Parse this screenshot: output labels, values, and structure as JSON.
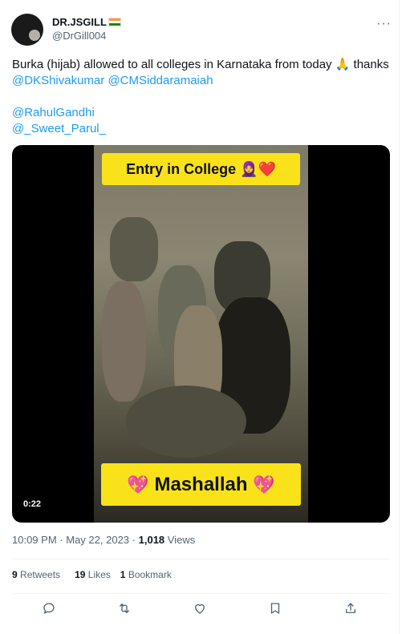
{
  "author": {
    "display_name": "DR.JSGILL",
    "handle": "@DrGill004",
    "flag_colors": [
      "#ff9933",
      "#ffffff",
      "#138808"
    ]
  },
  "tweet": {
    "line1": "Burka (hijab) allowed to all colleges in Karnataka from today 🙏 thanks",
    "mention1": "@DKShivakumar",
    "mention2": "@CMSiddaramaiah",
    "mention3": "@RahulGandhi",
    "mention4": "@_Sweet_Parul_"
  },
  "media": {
    "top_banner": "Entry in College 🧕❤️",
    "bottom_banner": "Mashallah",
    "bottom_banner_heart": "💖",
    "duration": "0:22"
  },
  "meta": {
    "time": "10:09 PM",
    "separator": "·",
    "date": "May 22, 2023",
    "views_count": "1,018",
    "views_label": "Views"
  },
  "stats": {
    "retweets_count": "9",
    "retweets_label": "Retweets",
    "likes_count": "19",
    "likes_label": "Likes",
    "bookmarks_count": "1",
    "bookmarks_label": "Bookmark"
  },
  "icons": {
    "more": "more-icon",
    "reply": "reply-icon",
    "retweet": "retweet-icon",
    "like": "heart-icon",
    "bookmark": "bookmark-icon",
    "share": "share-icon"
  },
  "colors": {
    "link": "#1d9bf0",
    "muted": "#536471",
    "banner": "#f9e21a"
  }
}
